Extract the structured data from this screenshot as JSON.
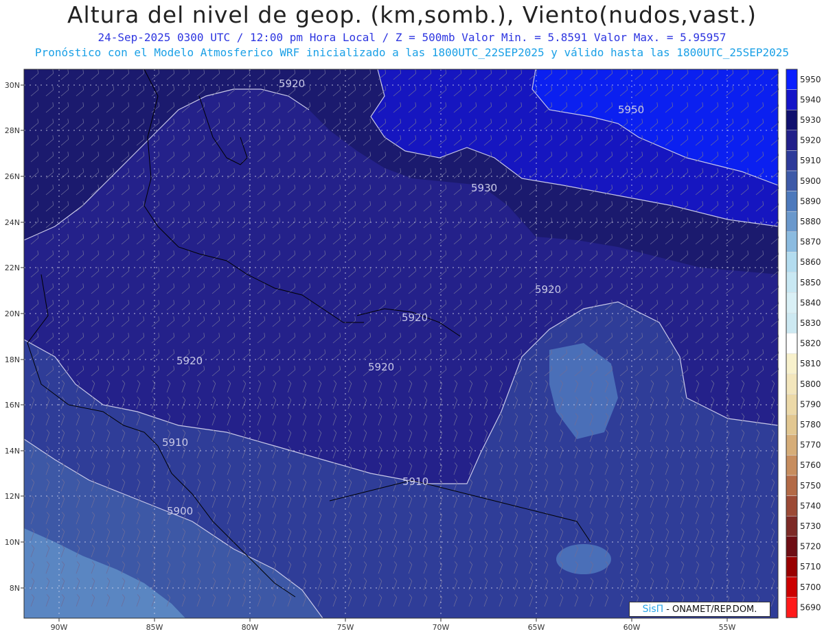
{
  "header": {
    "title": "Altura del nivel de geop. (km,somb.), Viento(nudos,vast.)",
    "subtitle1": "24-Sep-2025 0300 UTC / 12:00 pm Hora Local / Z = 500mb    Valor Min. = 5.8591  Valor Max. = 5.95957",
    "subtitle2": "Pronóstico con el Modelo Atmosferico WRF inicializado a las 1800UTC_22SEP2025 y válido hasta las  1800UTC_25SEP2025"
  },
  "axes": {
    "lon_labels": [
      "90W",
      "85W",
      "80W",
      "75W",
      "70W",
      "65W",
      "60W",
      "55W"
    ],
    "lat_labels": [
      "30N",
      "28N",
      "26N",
      "24N",
      "22N",
      "20N",
      "18N",
      "16N",
      "14N",
      "12N",
      "10N",
      "8N"
    ]
  },
  "contour_labels": [
    "5920",
    "5950",
    "5930",
    "5920",
    "5920",
    "5920",
    "5920",
    "5910",
    "5910",
    "5900"
  ],
  "colorbar": {
    "levels": [
      "5950",
      "5940",
      "5930",
      "5920",
      "5910",
      "5900",
      "5890",
      "5880",
      "5870",
      "5860",
      "5850",
      "5840",
      "5830",
      "5820",
      "5810",
      "5800",
      "5790",
      "5780",
      "5770",
      "5760",
      "5750",
      "5740",
      "5730",
      "5720",
      "5710",
      "5700",
      "5690"
    ],
    "colors": [
      "#0a1fff",
      "#1414c8",
      "#10106e",
      "#22208a",
      "#2d3a9a",
      "#3e5aa8",
      "#4d79bc",
      "#6a98cc",
      "#8bbbe0",
      "#b3dcef",
      "#c8e8f3",
      "#d9f0f6",
      "#cde9f2",
      "#ffffff",
      "#f8f1cc",
      "#f3e6bc",
      "#ecd9a8",
      "#e2c791",
      "#d6ad78",
      "#c78d5e",
      "#b36a46",
      "#9c4a35",
      "#7d2a26",
      "#6e0e14",
      "#990000",
      "#cc0000",
      "#ff1a1a"
    ]
  },
  "colors": {
    "z5950": "#0b20f0",
    "z5940": "#1616c0",
    "z5930": "#1b1a6e",
    "z5920": "#24218a",
    "z5910": "#2f3d98",
    "z5900": "#3d58a6",
    "z5890": "#5a86c2"
  },
  "logo": {
    "brand": "SisΠ",
    "text": "- ONAMET/REP.DOM."
  }
}
